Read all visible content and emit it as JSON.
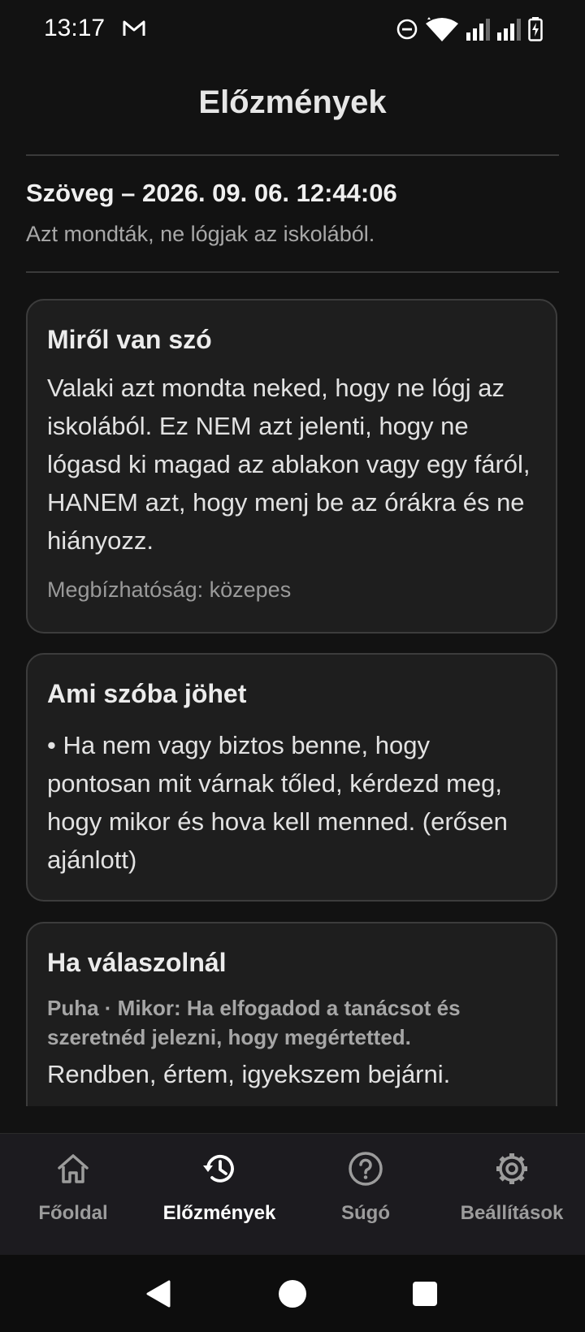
{
  "status_bar": {
    "time": "13:17",
    "icons": [
      "gmail-icon",
      "do-not-disturb-icon",
      "wifi-icon",
      "signal-icon",
      "signal-icon",
      "battery-charging-icon"
    ]
  },
  "header": {
    "title": "Előzmények"
  },
  "entry": {
    "heading": "Szöveg – 2026. 09. 06. 12:44:06",
    "text": "Azt mondták, ne lógjak az iskolából."
  },
  "cards": {
    "meaning": {
      "title": "Miről van szó",
      "body": "Valaki azt mondta neked, hogy ne lógj az iskolából. Ez NEM azt jelenti, hogy ne lógasd ki magad az ablakon vagy egy fáról, HANEM azt, hogy menj be az órákra és ne hiányozz.",
      "confidence": "Megbízhatóság: közepes"
    },
    "possible": {
      "title": "Ami szóba jöhet",
      "body": "• Ha nem vagy biztos benne, hogy pontosan mit várnak tőled, kérdezd meg, hogy mikor és hova kell menned. (erősen ajánlott)"
    },
    "reply": {
      "title": "Ha válaszolnál",
      "tone": "Puha · Mikor: Ha elfogadod a tanácsot és szeretnéd jelezni, hogy megértetted.",
      "suggestion": "Rendben, értem, igyekszem bejárni."
    }
  },
  "bottom_nav": {
    "items": [
      {
        "label": "Főoldal",
        "icon": "home-icon"
      },
      {
        "label": "Előzmények",
        "icon": "history-icon",
        "active": true
      },
      {
        "label": "Súgó",
        "icon": "help-icon"
      },
      {
        "label": "Beállítások",
        "icon": "settings-icon"
      }
    ]
  },
  "colors": {
    "background": "#121212",
    "card": "#1e1e1e",
    "nav": "#1c1b1f",
    "accent": "#ffffff"
  }
}
